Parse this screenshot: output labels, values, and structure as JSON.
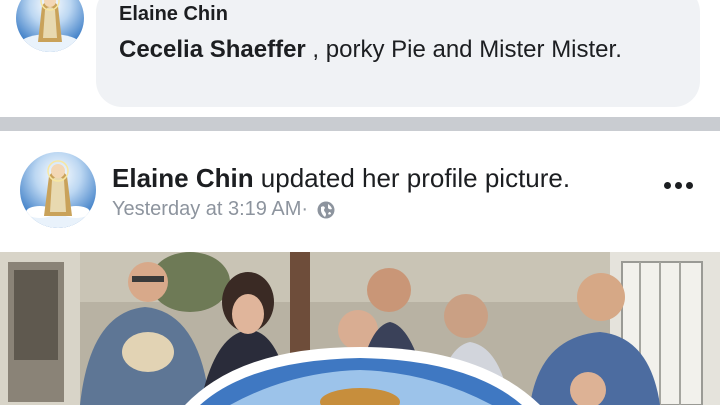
{
  "comment": {
    "author": "Elaine Chin",
    "mention": "Cecelia Shaeffer",
    "text": " , porky Pie and Mister Mister."
  },
  "post": {
    "author": "Elaine Chin",
    "action": " updated her profile picture.",
    "timestamp": "Yesterday at 3:19 AM",
    "separator": " ·",
    "privacy_icon": "globe-icon",
    "more_icon": "more-options-icon"
  },
  "colors": {
    "bubble": "#f0f2f5",
    "divider": "#c9ccd1",
    "meta": "#8d949e",
    "text": "#1c1e21"
  }
}
